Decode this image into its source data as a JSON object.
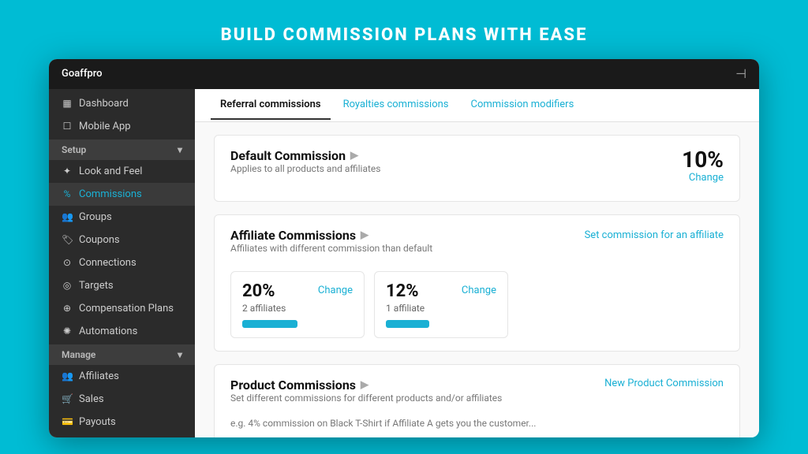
{
  "page": {
    "headline": "BUILD COMMISSION PLANS WITH EASE"
  },
  "titlebar": {
    "app_name": "Goaffpro",
    "logout_icon": "⊣"
  },
  "sidebar": {
    "top_items": [
      {
        "icon": "▦",
        "label": "Dashboard"
      },
      {
        "icon": "☐",
        "label": "Mobile App"
      }
    ],
    "setup_section": {
      "label": "Setup",
      "items": [
        {
          "icon": "✦",
          "label": "Look and Feel"
        },
        {
          "icon": "%",
          "label": "Commissions",
          "active": true
        },
        {
          "icon": "👥",
          "label": "Groups"
        },
        {
          "icon": "🏷",
          "label": "Coupons"
        },
        {
          "icon": "⊙",
          "label": "Connections"
        },
        {
          "icon": "◎",
          "label": "Targets"
        },
        {
          "icon": "⊕",
          "label": "Compensation Plans"
        },
        {
          "icon": "✺",
          "label": "Automations"
        }
      ]
    },
    "manage_section": {
      "label": "Manage",
      "items": [
        {
          "icon": "👥",
          "label": "Affiliates"
        },
        {
          "icon": "🛒",
          "label": "Sales"
        },
        {
          "icon": "💳",
          "label": "Payouts"
        }
      ]
    }
  },
  "tabs": [
    {
      "label": "Referral commissions",
      "active": true
    },
    {
      "label": "Royalties commissions",
      "link": true
    },
    {
      "label": "Commission modifiers",
      "link": true
    }
  ],
  "default_commission": {
    "title": "Default Commission",
    "subtitle": "Applies to all products and affiliates",
    "value": "10%",
    "change_label": "Change"
  },
  "affiliate_commissions": {
    "title": "Affiliate Commissions",
    "subtitle": "Affiliates with different commission than default",
    "set_link": "Set commission for an affiliate",
    "cards": [
      {
        "percent": "20%",
        "affiliates": "2 affiliates",
        "change": "Change",
        "bar_width": "70"
      },
      {
        "percent": "12%",
        "affiliates": "1 affiliate",
        "change": "Change",
        "bar_width": "55"
      }
    ]
  },
  "product_commissions": {
    "title": "Product Commissions",
    "subtitle": "Set different commissions for different products and/or affiliates",
    "new_link": "New Product Commission",
    "note": "e.g. 4% commission on Black T-Shirt if Affiliate A gets you the customer..."
  }
}
